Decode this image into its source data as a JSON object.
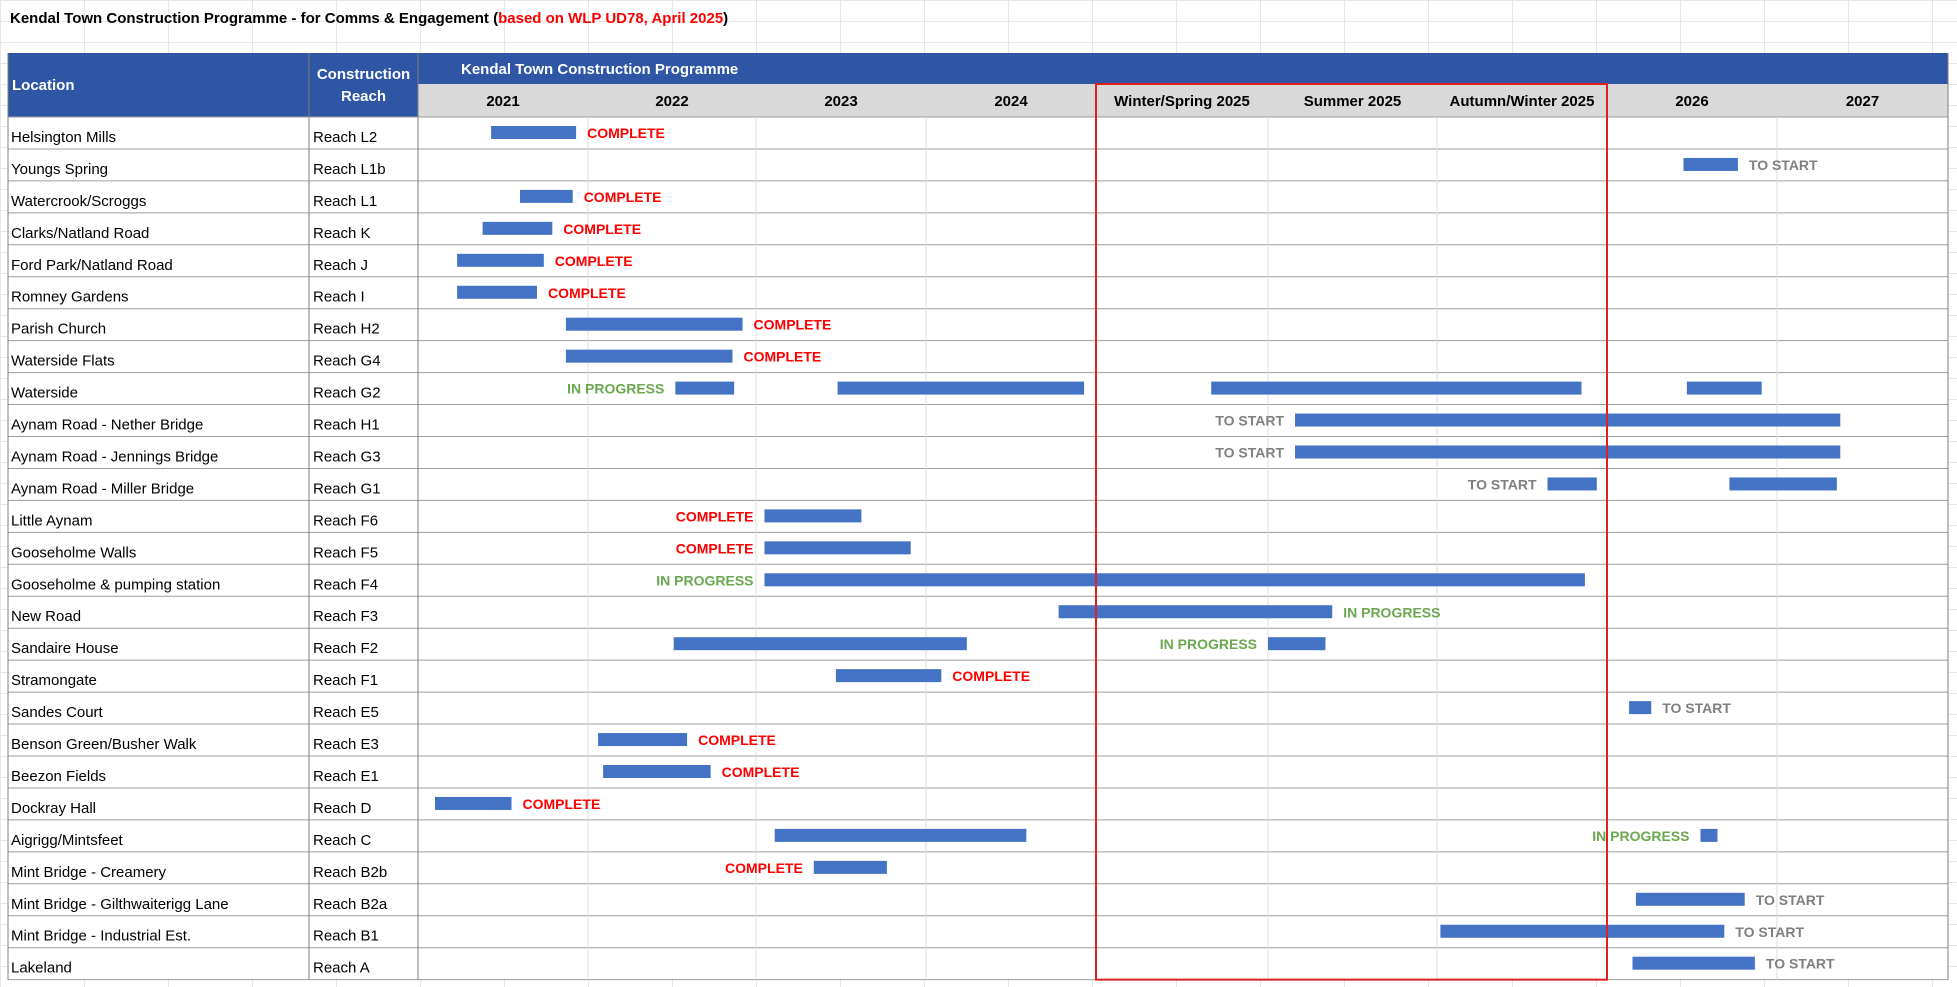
{
  "page_title": {
    "main": "Kendal Town Construction Programme - for Comms & Engagement (",
    "highlight": "based on WLP UD78, April 2025",
    "close": ")"
  },
  "colors": {
    "header_blue": "#2f55a5",
    "period_bg": "#d9d9d9",
    "bar": "#4472c4",
    "complete": "#ff0000",
    "in_progress": "#6aa84f",
    "to_start": "#7f7f7f",
    "current_year_frame": "#e02020"
  },
  "chart_data": {
    "type": "gantt",
    "title": "Kendal Town Construction Programme",
    "column_headers": {
      "location": "Location",
      "reach": "Construction Reach"
    },
    "time_axis": {
      "unit": "years",
      "range": [
        2020.5,
        2027.5
      ],
      "periods": [
        {
          "label": "2021",
          "start": 2020.5,
          "end": 2021.5
        },
        {
          "label": "2022",
          "start": 2021.5,
          "end": 2022.5
        },
        {
          "label": "2023",
          "start": 2022.5,
          "end": 2023.5
        },
        {
          "label": "2024",
          "start": 2023.5,
          "end": 2024.5
        },
        {
          "label": "Winter/Spring 2025",
          "start": 2024.5,
          "end": 2025.5
        },
        {
          "label": "Summer 2025",
          "start": 2025.5,
          "end": 2026.5
        },
        {
          "label": "Autumn/Winter 2025",
          "start": 2026.5,
          "end": 2027.5
        },
        {
          "label": "2026",
          "start": 2027.5,
          "end": 2028.5
        },
        {
          "label": "2027",
          "start": 2028.5,
          "end": 2029.5
        }
      ],
      "highlighted_periods": [
        "Winter/Spring 2025",
        "Summer 2025",
        "Autumn/Winter 2025"
      ]
    },
    "status_labels": {
      "complete": "COMPLETE",
      "in_progress": "IN PROGRESS",
      "to_start": "TO START"
    },
    "rows": [
      {
        "location": "Helsington Mills",
        "reach": "Reach L2",
        "bars": [
          [
            2020.93,
            2021.43
          ]
        ],
        "status": "complete",
        "label_at": "after"
      },
      {
        "location": "Youngs Spring",
        "reach": "Reach L1b",
        "bars": [
          [
            2027.95,
            2028.27
          ]
        ],
        "status": "to_start",
        "label_at": "after"
      },
      {
        "location": "Watercrook/Scroggs",
        "reach": "Reach L1",
        "bars": [
          [
            2021.1,
            2021.41
          ]
        ],
        "status": "complete",
        "label_at": "after"
      },
      {
        "location": "Clarks/Natland Road",
        "reach": "Reach K",
        "bars": [
          [
            2020.88,
            2021.29
          ]
        ],
        "status": "complete",
        "label_at": "after"
      },
      {
        "location": "Ford Park/Natland Road",
        "reach": "Reach J",
        "bars": [
          [
            2020.73,
            2021.24
          ]
        ],
        "status": "complete",
        "label_at": "after"
      },
      {
        "location": "Romney Gardens",
        "reach": "Reach I",
        "bars": [
          [
            2020.73,
            2021.2
          ]
        ],
        "status": "complete",
        "label_at": "after"
      },
      {
        "location": "Parish Church",
        "reach": "Reach H2",
        "bars": [
          [
            2021.37,
            2022.42
          ]
        ],
        "status": "complete",
        "label_at": "after"
      },
      {
        "location": "Waterside Flats",
        "reach": "Reach G4",
        "bars": [
          [
            2021.37,
            2022.36
          ]
        ],
        "status": "complete",
        "label_at": "after"
      },
      {
        "location": "Waterside",
        "reach": "Reach G2",
        "bars": [
          [
            2022.02,
            2022.37
          ],
          [
            2022.98,
            2024.43
          ],
          [
            2025.17,
            2027.35
          ],
          [
            2027.97,
            2028.41
          ]
        ],
        "status": "in_progress",
        "label_at": "before"
      },
      {
        "location": "Aynam Road - Nether Bridge",
        "reach": "Reach H1",
        "bars": [
          [
            2025.66,
            2028.87
          ]
        ],
        "status": "to_start",
        "label_at": "before"
      },
      {
        "location": "Aynam Road - Jennings Bridge",
        "reach": "Reach G3",
        "bars": [
          [
            2025.66,
            2028.87
          ]
        ],
        "status": "to_start",
        "label_at": "before"
      },
      {
        "location": "Aynam Road - Miller Bridge",
        "reach": "Reach G1",
        "bars": [
          [
            2027.15,
            2027.44
          ],
          [
            2028.22,
            2028.85
          ]
        ],
        "status": "to_start",
        "label_at": "before"
      },
      {
        "location": "Little Aynam",
        "reach": "Reach F6",
        "bars": [
          [
            2022.55,
            2023.12
          ]
        ],
        "status": "complete",
        "label_at": "before"
      },
      {
        "location": "Gooseholme Walls",
        "reach": "Reach F5",
        "bars": [
          [
            2022.55,
            2023.41
          ]
        ],
        "status": "complete",
        "label_at": "before"
      },
      {
        "location": "Gooseholme & pumping station",
        "reach": "Reach F4",
        "bars": [
          [
            2022.55,
            2027.37
          ]
        ],
        "status": "in_progress",
        "label_at": "before"
      },
      {
        "location": "New Road",
        "reach": "Reach F3",
        "bars": [
          [
            2024.28,
            2025.88
          ]
        ],
        "status": "in_progress",
        "label_at": "after"
      },
      {
        "location": "Sandaire House",
        "reach": "Reach F2",
        "bars": [
          [
            2022.01,
            2023.74
          ],
          [
            2025.5,
            2025.84
          ]
        ],
        "status": "in_progress",
        "label_at": "before_last"
      },
      {
        "location": "Stramongate",
        "reach": "Reach F1",
        "bars": [
          [
            2022.97,
            2023.59
          ]
        ],
        "status": "complete",
        "label_at": "after"
      },
      {
        "location": "Sandes Court",
        "reach": "Reach E5",
        "bars": [
          [
            2027.63,
            2027.76
          ]
        ],
        "status": "to_start",
        "label_at": "after"
      },
      {
        "location": "Benson Green/Busher Walk",
        "reach": "Reach E3",
        "bars": [
          [
            2021.56,
            2022.09
          ]
        ],
        "status": "complete",
        "label_at": "after"
      },
      {
        "location": "Beezon Fields",
        "reach": "Reach E1",
        "bars": [
          [
            2021.59,
            2022.23
          ]
        ],
        "status": "complete",
        "label_at": "after"
      },
      {
        "location": "Dockray Hall",
        "reach": "Reach D",
        "bars": [
          [
            2020.6,
            2021.05
          ]
        ],
        "status": "complete",
        "label_at": "after"
      },
      {
        "location": "Aigrigg/Mintsfeet",
        "reach": "Reach C",
        "bars": [
          [
            2022.61,
            2024.09
          ],
          [
            2028.05,
            2028.15
          ]
        ],
        "status": "in_progress",
        "label_at": "before_last"
      },
      {
        "location": "Mint Bridge - Creamery",
        "reach": "Reach B2b",
        "bars": [
          [
            2022.84,
            2023.27
          ]
        ],
        "status": "complete",
        "label_at": "before"
      },
      {
        "location": "Mint Bridge - Gilthwaiterigg Lane",
        "reach": "Reach B2a",
        "bars": [
          [
            2027.67,
            2028.31
          ]
        ],
        "status": "to_start",
        "label_at": "after"
      },
      {
        "location": "Mint Bridge - Industrial Est.",
        "reach": "Reach B1",
        "bars": [
          [
            2026.52,
            2028.19
          ]
        ],
        "status": "to_start",
        "label_at": "after"
      },
      {
        "location": "Lakeland",
        "reach": "Reach A",
        "bars": [
          [
            2027.65,
            2028.37
          ]
        ],
        "status": "to_start",
        "label_at": "after"
      }
    ]
  }
}
